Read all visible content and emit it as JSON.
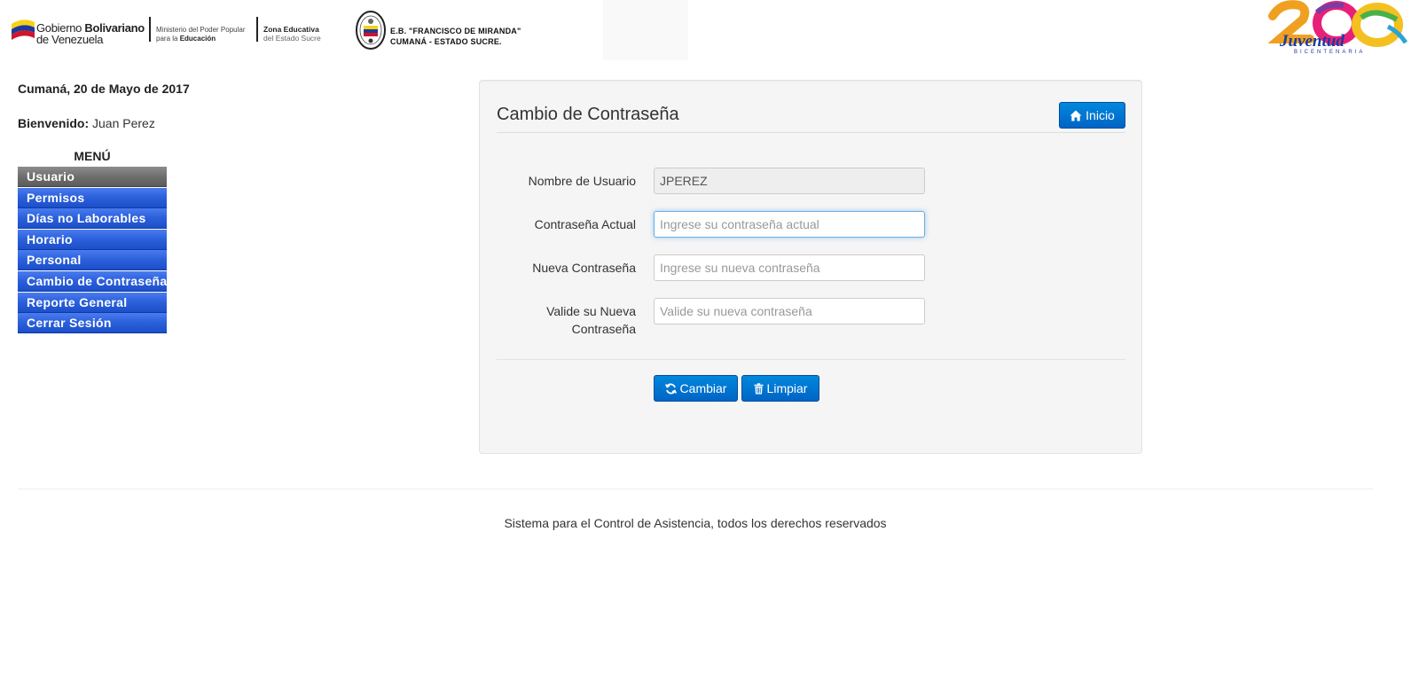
{
  "header": {
    "gobierno_line1_a": "Gobierno ",
    "gobierno_line1_b": "Bolivariano",
    "gobierno_line2": "de Venezuela",
    "ministerio_line1": "Ministerio  del Poder Popular",
    "ministerio_line2_a": "para la ",
    "ministerio_line2_b": "Educación",
    "zona_line1": "Zona Educativa",
    "zona_line2": "del Estado Sucre",
    "school_line1": "E.B. \"FRANCISCO DE MIRANDA\"",
    "school_line2": "CUMANÁ - ESTADO SUCRE.",
    "right_logo_text": "Juventud",
    "right_logo_sub": "BICENTENARIA"
  },
  "sidebar": {
    "date": "Cumaná, 20 de Mayo de 2017",
    "welcome_label": "Bienvenido:",
    "welcome_user": " Juan Perez",
    "menu_title": "MENÚ",
    "items": [
      {
        "label": "Usuario"
      },
      {
        "label": "Permisos"
      },
      {
        "label": "Días no Laborables"
      },
      {
        "label": "Horario"
      },
      {
        "label": "Personal"
      },
      {
        "label": "Cambio de Contraseña"
      },
      {
        "label": "Reporte General"
      },
      {
        "label": "Cerrar Sesión"
      }
    ]
  },
  "panel": {
    "title": "Cambio de Contraseña",
    "inicio_label": "Inicio",
    "fields": {
      "username_label": "Nombre de Usuario",
      "username_value": "JPEREZ",
      "current_label": "Contraseña Actual",
      "current_placeholder": "Ingrese su contraseña actual",
      "new_label": "Nueva Contraseña",
      "new_placeholder": "Ingrese su nueva contraseña",
      "confirm_label_1": "Valide su Nueva",
      "confirm_label_2": "Contraseña",
      "confirm_placeholder": "Valide su nueva contraseña"
    },
    "cambiar_label": "Cambiar",
    "limpiar_label": "Limpiar"
  },
  "footer": {
    "text": "Sistema para el Control de Asistencia, todos los derechos reservados"
  },
  "colors": {
    "menu_blue": "#2d62dd",
    "menu_active": "#6f6f6f",
    "button_blue": "#0070d0"
  }
}
